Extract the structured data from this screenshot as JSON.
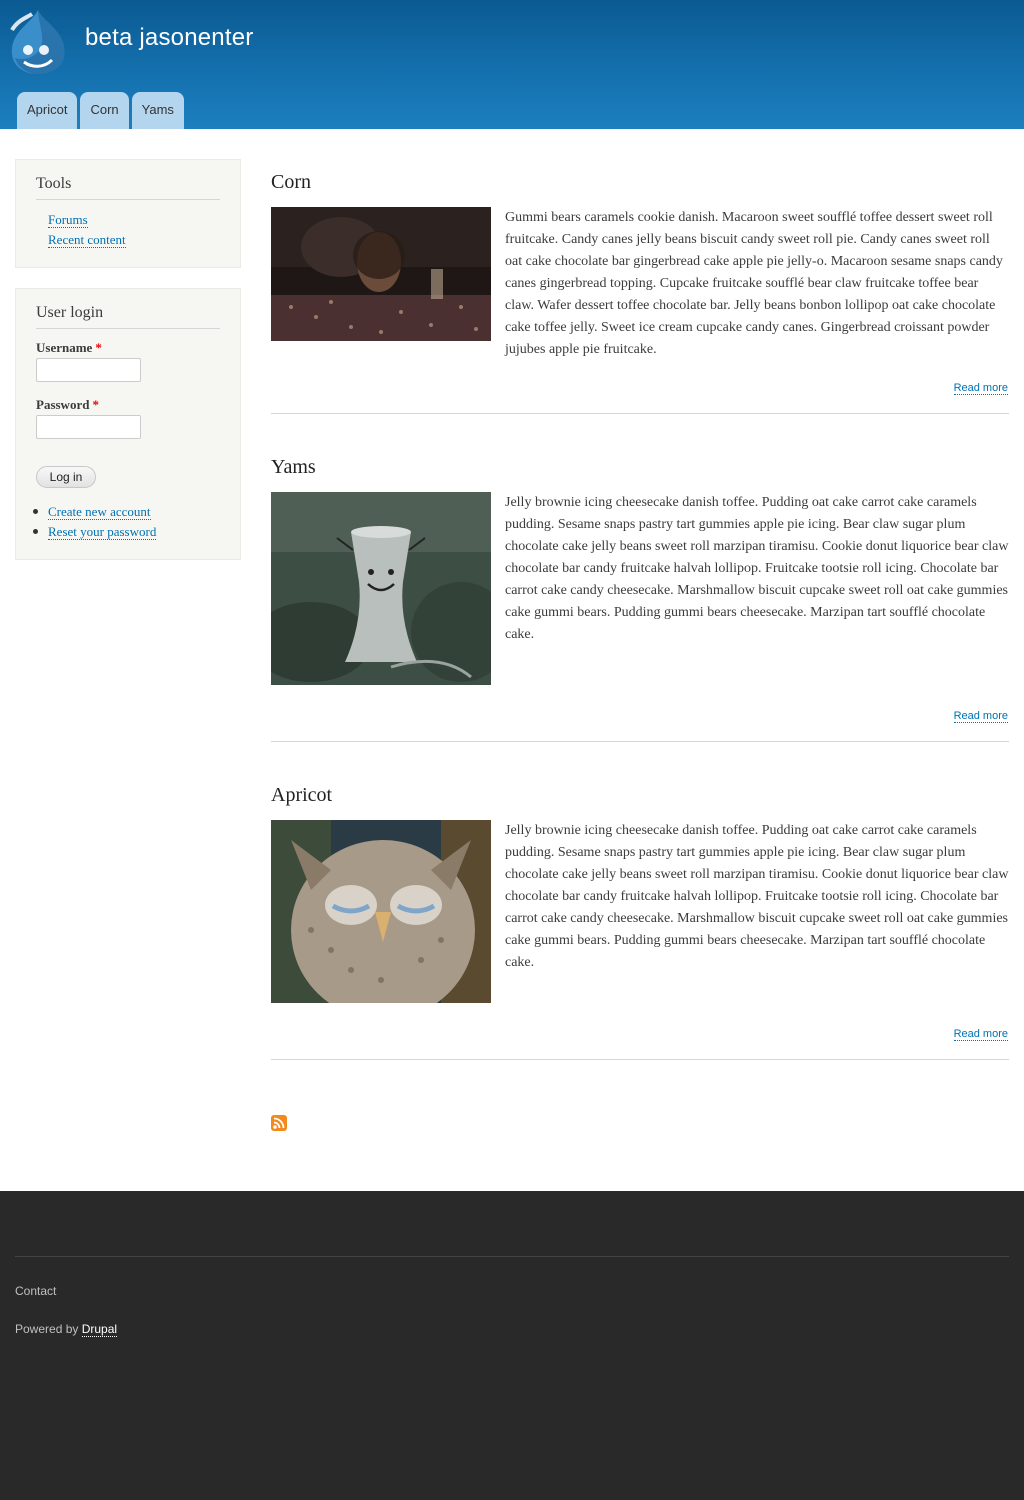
{
  "header": {
    "site_name": "beta jasonenter",
    "tabs": [
      "Apricot",
      "Corn",
      "Yams"
    ],
    "gradient_top": "#0b5a92",
    "gradient_bottom": "#1d7fbf"
  },
  "sidebar": {
    "tools": {
      "title": "Tools",
      "links": [
        "Forums",
        "Recent content"
      ]
    },
    "login": {
      "title": "User login",
      "username_label": "Username",
      "password_label": "Password",
      "required_mark": "*",
      "button": "Log in",
      "links": [
        "Create new account",
        "Reset your password"
      ]
    }
  },
  "nodes": [
    {
      "title": "Corn",
      "image": "person-at-table-photo",
      "body": "Gummi bears caramels cookie danish. Macaroon sweet soufflé toffee dessert sweet roll fruitcake. Candy canes jelly beans biscuit candy sweet roll pie. Candy canes sweet roll oat cake chocolate bar gingerbread cake apple pie jelly-o. Macaroon sesame snaps candy canes gingerbread topping. Cupcake fruitcake soufflé bear claw fruitcake toffee bear claw. Wafer dessert toffee chocolate bar. Jelly beans bonbon lollipop oat cake chocolate cake toffee jelly. Sweet ice cream cupcake candy canes. Gingerbread croissant powder jujubes apple pie fruitcake.",
      "read_more": "Read more"
    },
    {
      "title": "Yams",
      "image": "smiling-cooling-tower-photo",
      "body": "Jelly brownie icing cheesecake danish toffee. Pudding oat cake carrot cake caramels pudding. Sesame snaps pastry tart gummies apple pie icing. Bear claw sugar plum chocolate cake jelly beans sweet roll marzipan tiramisu. Cookie donut liquorice bear claw chocolate bar candy fruitcake halvah lollipop. Fruitcake tootsie roll icing. Chocolate bar carrot cake candy cheesecake. Marshmallow biscuit cupcake sweet roll oat cake gummies cake gummi bears. Pudding gummi bears cheesecake. Marzipan tart soufflé chocolate cake.",
      "read_more": "Read more"
    },
    {
      "title": "Apricot",
      "image": "sleepy-owl-photo",
      "body": "Jelly brownie icing cheesecake danish toffee. Pudding oat cake carrot cake caramels pudding. Sesame snaps pastry tart gummies apple pie icing. Bear claw sugar plum chocolate cake jelly beans sweet roll marzipan tiramisu. Cookie donut liquorice bear claw chocolate bar candy fruitcake halvah lollipop. Fruitcake tootsie roll icing. Chocolate bar carrot cake candy cheesecake. Marshmallow biscuit cupcake sweet roll oat cake gummies cake gummi bears. Pudding gummi bears cheesecake. Marzipan tart soufflé chocolate cake.",
      "read_more": "Read more"
    }
  ],
  "feed_icon": "rss-icon",
  "footer": {
    "contact": "Contact",
    "powered_prefix": "Powered by",
    "powered_link": "Drupal",
    "background": "#292929"
  },
  "link_color": "#0071b3"
}
